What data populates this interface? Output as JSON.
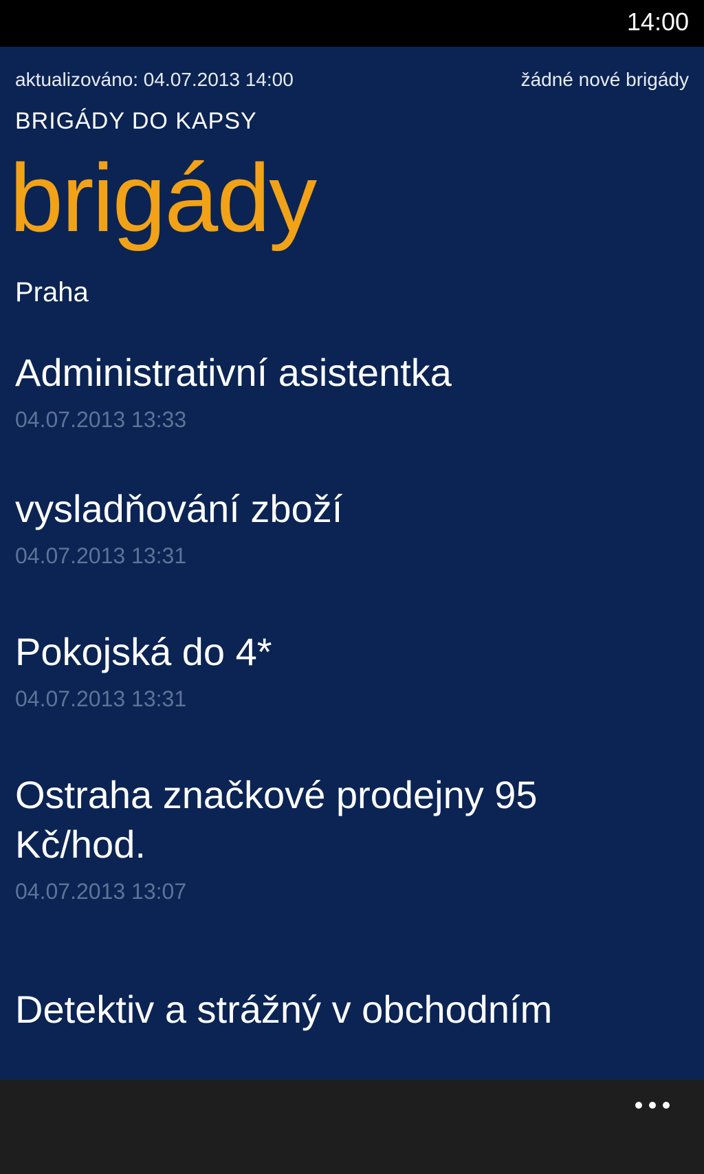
{
  "status_bar": {
    "time": "14:00"
  },
  "header": {
    "updated": "aktualizováno: 04.07.2013 14:00",
    "new_jobs": "žádné nové brigády",
    "app_name": "BRIGÁDY DO KAPSY",
    "title": "brigády",
    "location": "Praha"
  },
  "jobs": [
    {
      "title": "Administrativní asistentka",
      "time": "04.07.2013 13:33"
    },
    {
      "title": "vysladňování zboží",
      "time": "04.07.2013 13:31"
    },
    {
      "title": "Pokojská do 4*",
      "time": "04.07.2013 13:31"
    },
    {
      "title": "Ostraha značkové prodejny 95 Kč/hod.",
      "time": "04.07.2013 13:07"
    },
    {
      "title": "Detektiv a strážný v obchodním",
      "time": ""
    }
  ],
  "app_bar": {
    "more_icon": "ellipsis-icon"
  },
  "colors": {
    "background": "#0b2454",
    "accent": "#f2a217",
    "secondary_text": "#5e7397",
    "app_bar": "#1e1e1e"
  }
}
